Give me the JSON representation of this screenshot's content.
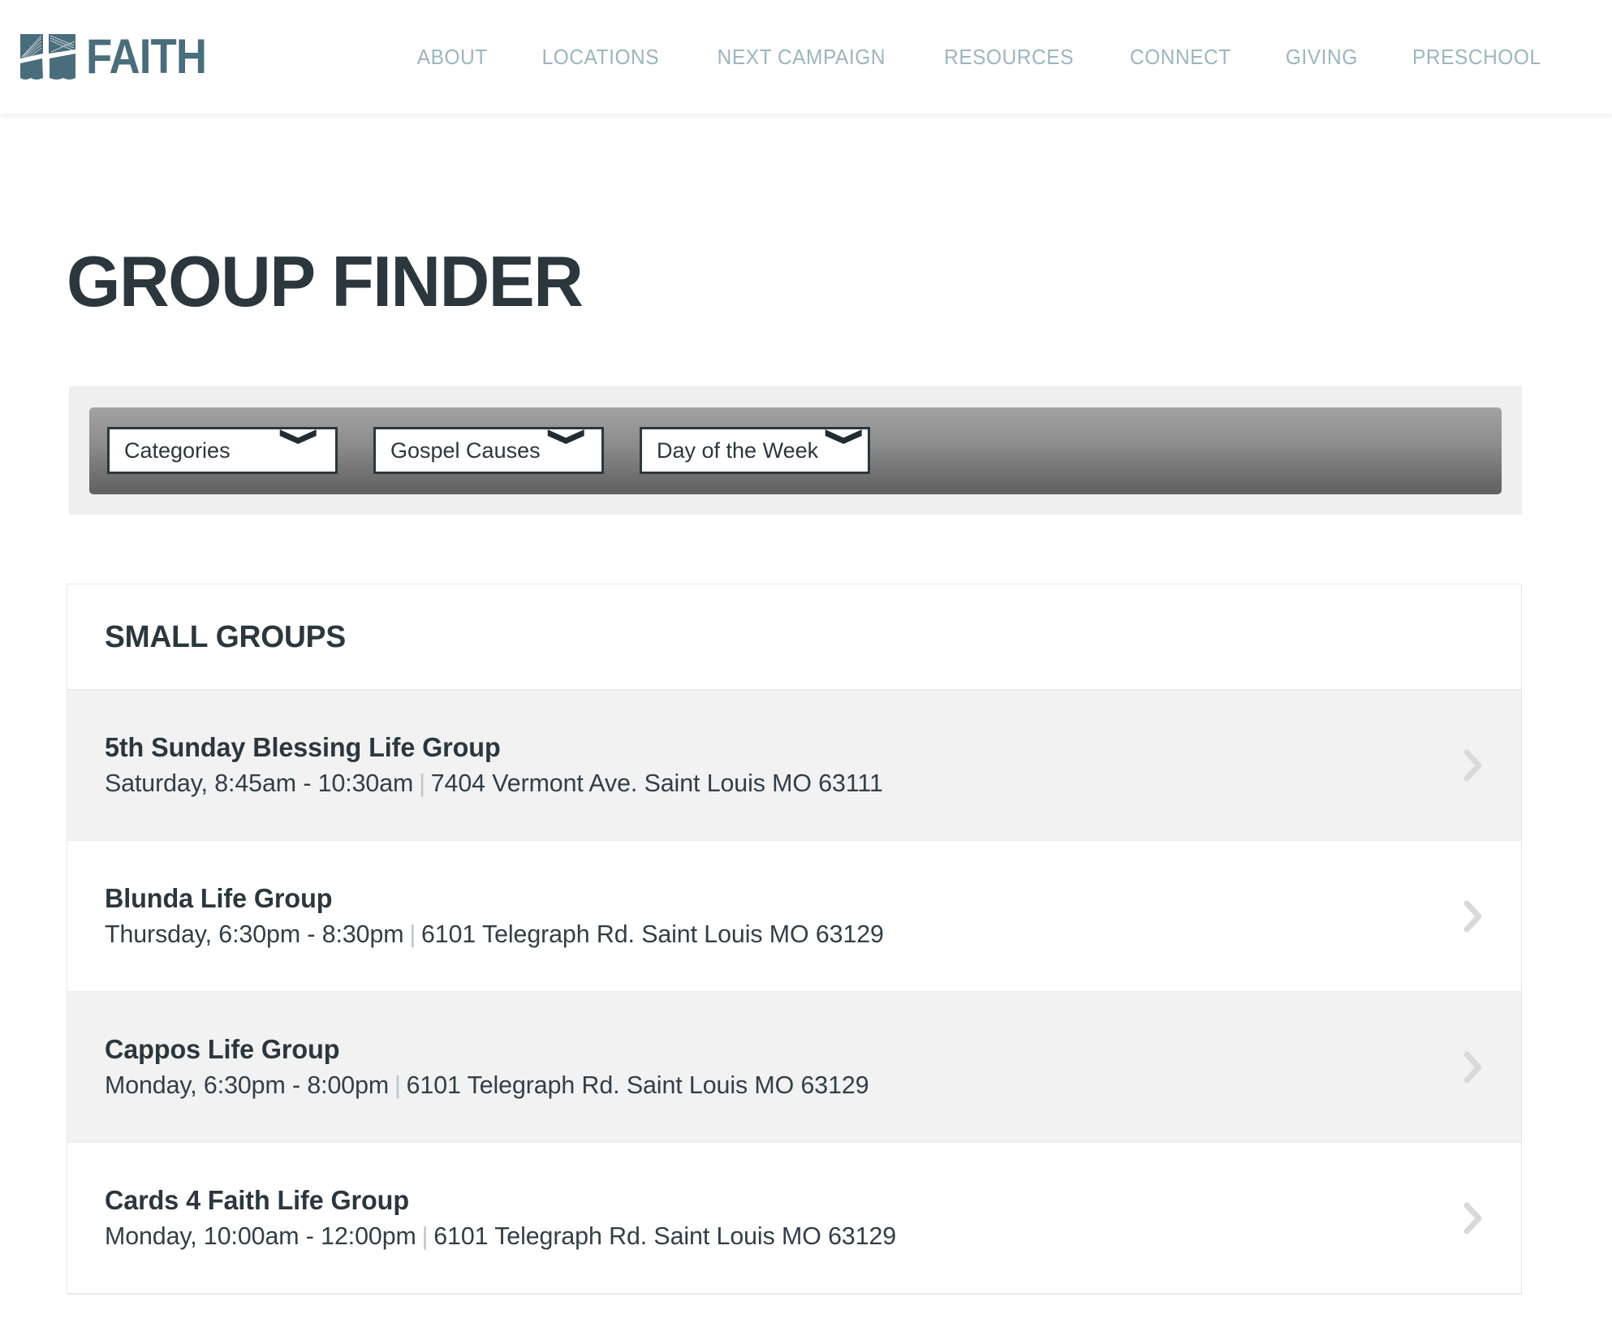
{
  "header": {
    "brand": {
      "wordmark": "FAITH",
      "logo_icon": "faith-cross-logo-icon",
      "logo_color": "#4a6d7c"
    },
    "nav": [
      {
        "label": "ABOUT",
        "name": "nav-link-about"
      },
      {
        "label": "LOCATIONS",
        "name": "nav-link-locations"
      },
      {
        "label": "NEXT CAMPAIGN",
        "name": "nav-link-next-campaign"
      },
      {
        "label": "RESOURCES",
        "name": "nav-link-resources"
      },
      {
        "label": "CONNECT",
        "name": "nav-link-connect"
      },
      {
        "label": "GIVING",
        "name": "nav-link-giving"
      },
      {
        "label": "PRESCHOOL",
        "name": "nav-link-preschool"
      }
    ],
    "nav_color": "#9db5bf"
  },
  "page": {
    "title": "GROUP FINDER",
    "title_color": "#2b373d"
  },
  "filters": {
    "categories": {
      "label": "Categories",
      "caret": "chevron-down-icon"
    },
    "gospel_causes": {
      "label": "Gospel Causes",
      "caret": "chevron-down-icon"
    },
    "day_of_week": {
      "label": "Day of the Week",
      "caret": "chevron-down-icon"
    }
  },
  "results": {
    "heading": "SMALL GROUPS",
    "row_arrow_icon": "chevron-right-icon",
    "separator": "|",
    "groups": [
      {
        "name": "5th Sunday Blessing Life Group",
        "schedule": "Saturday, 8:45am - 10:30am",
        "address": "7404 Vermont Ave. Saint Louis MO 63111"
      },
      {
        "name": "Blunda Life Group",
        "schedule": "Thursday, 6:30pm - 8:30pm",
        "address": "6101 Telegraph Rd. Saint Louis MO 63129"
      },
      {
        "name": "Cappos Life Group",
        "schedule": "Monday, 6:30pm - 8:00pm",
        "address": "6101 Telegraph Rd. Saint Louis MO 63129"
      },
      {
        "name": "Cards 4 Faith Life Group",
        "schedule": "Monday, 10:00am - 12:00pm",
        "address": "6101 Telegraph Rd. Saint Louis MO 63129"
      }
    ]
  }
}
